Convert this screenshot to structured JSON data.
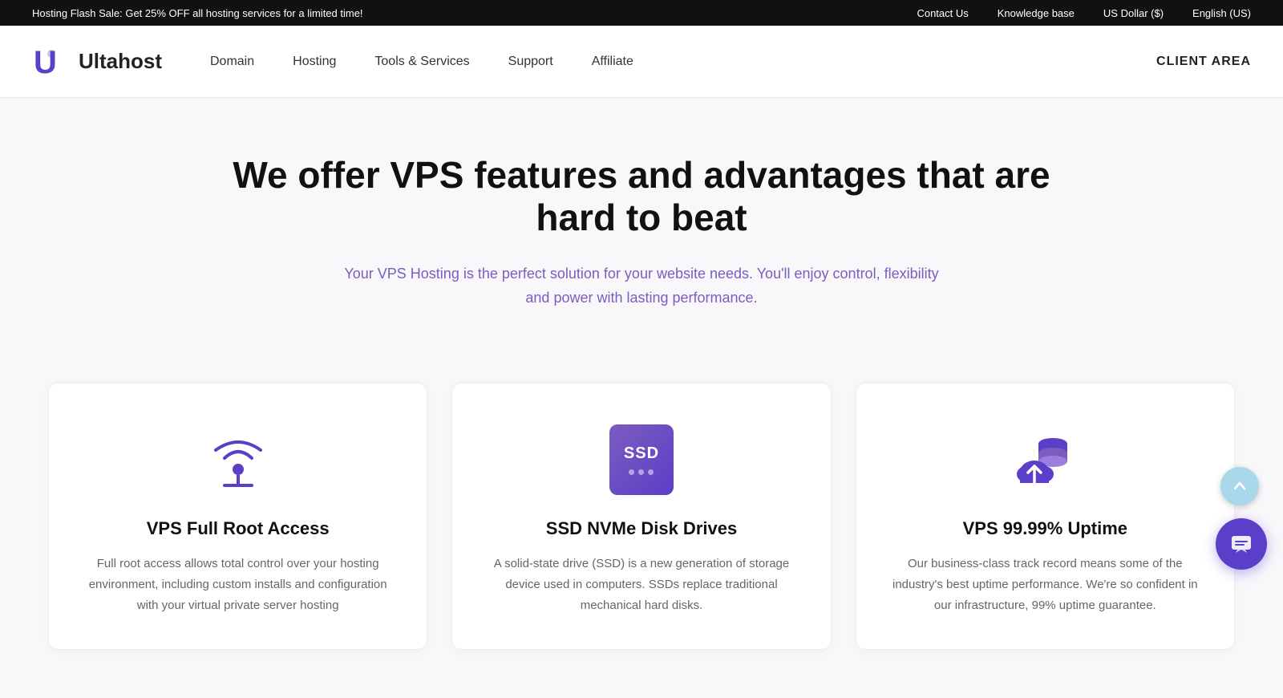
{
  "topbar": {
    "promo": "Hosting Flash Sale: Get 25% OFF all hosting services for a limited time!",
    "links": [
      {
        "label": "Contact Us"
      },
      {
        "label": "Knowledge base"
      },
      {
        "label": "US Dollar ($)"
      },
      {
        "label": "English (US)"
      }
    ]
  },
  "navbar": {
    "logo_text": "Ultahost",
    "nav_items": [
      {
        "label": "Domain"
      },
      {
        "label": "Hosting"
      },
      {
        "label": "Tools & Services"
      },
      {
        "label": "Support"
      },
      {
        "label": "Affiliate"
      }
    ],
    "client_area": "CLIENT AREA"
  },
  "hero": {
    "title": "We offer VPS features and advantages that are hard to beat",
    "description_plain": "Your VPS Hosting is the perfect solution for your website needs. You'll enjoy control, flexibility and power with ",
    "description_highlight": "lasting performance",
    "description_end": "."
  },
  "cards": [
    {
      "id": "vps-root",
      "icon_name": "wifi-router-icon",
      "title": "VPS Full Root Access",
      "description": "Full root access allows total control over your hosting environment, including custom installs and configuration with your virtual private server hosting"
    },
    {
      "id": "ssd-nvme",
      "icon_name": "ssd-drive-icon",
      "title": "SSD NVMe Disk Drives",
      "description": "A solid-state drive (SSD) is a new generation of storage device used in computers. SSDs replace traditional mechanical hard disks."
    },
    {
      "id": "uptime",
      "icon_name": "cloud-upload-icon",
      "title": "VPS 99.99% Uptime",
      "description": "Our business-class track record means some of the industry's best uptime performance. We're so confident in our infrastructure, 99% uptime guarantee."
    }
  ]
}
